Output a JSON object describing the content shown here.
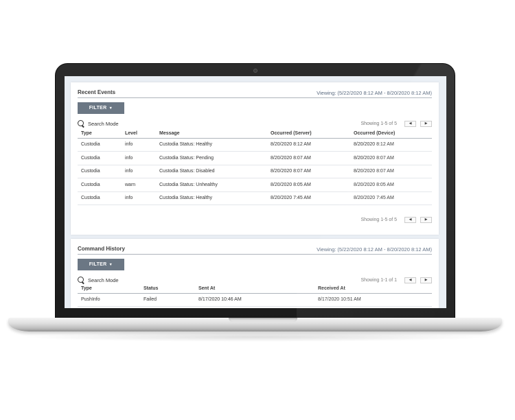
{
  "recent_events": {
    "title": "Recent Events",
    "viewing": "Viewing: (5/22/2020 8:12 AM - 8/20/2020 8:12 AM)",
    "filter_label": "FILTER",
    "search_label": "Search Mode",
    "pager_text": "Showing 1-5 of 5",
    "columns": [
      "Type",
      "Level",
      "Message",
      "Occurred (Server)",
      "Occurred (Device)"
    ],
    "rows": [
      [
        "Custodia",
        "info",
        "Custodia Status: Healthy",
        "8/20/2020 8:12 AM",
        "8/20/2020 8:12 AM"
      ],
      [
        "Custodia",
        "info",
        "Custodia Status: Pending",
        "8/20/2020 8:07 AM",
        "8/20/2020 8:07 AM"
      ],
      [
        "Custodia",
        "info",
        "Custodia Status: Disabled",
        "8/20/2020 8:07 AM",
        "8/20/2020 8:07 AM"
      ],
      [
        "Custodia",
        "warn",
        "Custodia Status: Unhealthy",
        "8/20/2020 8:05 AM",
        "8/20/2020 8:05 AM"
      ],
      [
        "Custodia",
        "info",
        "Custodia Status: Healthy",
        "8/20/2020 7:45 AM",
        "8/20/2020 7:45 AM"
      ]
    ]
  },
  "command_history": {
    "title": "Command History",
    "viewing": "Viewing: (5/22/2020 8:12 AM - 8/20/2020 8:12 AM)",
    "filter_label": "FILTER",
    "search_label": "Search Mode",
    "pager_text": "Showing 1-1 of 1",
    "columns": [
      "Type",
      "Status",
      "Sent At",
      "Received At"
    ],
    "rows": [
      [
        "PushInfo",
        "Failed",
        "8/17/2020 10:46 AM",
        "8/17/2020 10:51 AM"
      ]
    ]
  },
  "icons": {
    "search": "search-icon",
    "caret": "caret-down-icon",
    "prev": "chevron-left-icon",
    "next": "chevron-right-icon"
  },
  "colors": {
    "filter_button": "#6b7784",
    "viewing_text": "#5b6b80",
    "screen_background": "#e9eef4"
  }
}
